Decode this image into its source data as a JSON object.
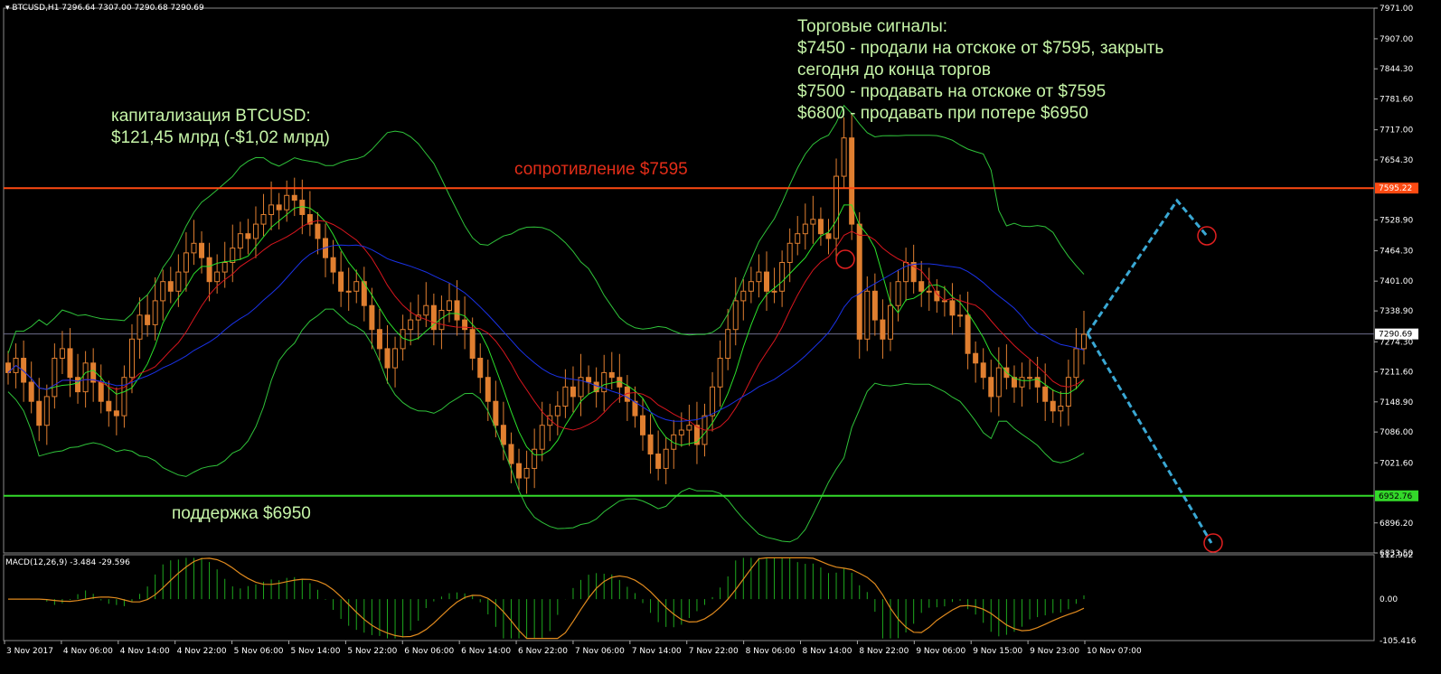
{
  "header": {
    "symbol": "BTCUSD,H1",
    "ohlc": "7296.64 7307.00 7290.68 7290.69",
    "macd_label": "MACD(12,26,9) -3.484 -29.596"
  },
  "annotations": {
    "cap_line1": "капитализация BTCUSD:",
    "cap_line2": "$121,45 млрд (-$1,02 млрд)",
    "signals": [
      "Торговые сигналы:",
      "$7450 - продали на отскоке от $7595, закрыть",
      "сегодня до конца торгов",
      "$7500 - продавать на отскоке от $7595",
      "$6800 - продавать при потере $6950"
    ],
    "resistance_label": "сопротивление $7595",
    "support_label": "поддержка $6950"
  },
  "price_axis": {
    "ticks": [
      "7971.00",
      "7907.00",
      "7844.30",
      "7781.60",
      "7717.00",
      "7654.30",
      "7528.90",
      "7464.30",
      "7401.00",
      "7338.90",
      "7274.30",
      "7211.60",
      "7148.90",
      "7086.00",
      "7021.60",
      "6896.20",
      "6833.50"
    ],
    "current_price": "7290.69",
    "resistance_price": "7595.22",
    "support_price": "6952.76"
  },
  "macd_axis": {
    "ticks": [
      "112.902",
      "0.00",
      "-105.416"
    ]
  },
  "time_axis": {
    "labels": [
      "3 Nov 2017",
      "4 Nov 06:00",
      "4 Nov 14:00",
      "4 Nov 22:00",
      "5 Nov 06:00",
      "5 Nov 14:00",
      "5 Nov 22:00",
      "6 Nov 06:00",
      "6 Nov 14:00",
      "6 Nov 22:00",
      "7 Nov 06:00",
      "7 Nov 14:00",
      "7 Nov 22:00",
      "8 Nov 06:00",
      "8 Nov 14:00",
      "8 Nov 22:00",
      "9 Nov 06:00",
      "9 Nov 15:00",
      "9 Nov 23:00",
      "10 Nov 07:00"
    ]
  },
  "colors": {
    "candle": "#e07f30",
    "resistance": "#ff4a12",
    "support": "#33d92a",
    "bollinger": "#2fc33a",
    "ma_red": "#d8161e",
    "ma_blue": "#1a32e8",
    "ma_green": "#2be22b",
    "macd_hist": "#1ea91e",
    "macd_signal": "#e08a1e",
    "forecast": "#3aa8d4"
  },
  "chart_data": {
    "type": "candlestick",
    "title": "BTCUSD,H1",
    "ylim": [
      6833.5,
      7971
    ],
    "resistance": 7595.22,
    "support": 6952.76,
    "current": 7290.69,
    "closes": [
      7210,
      7240,
      7190,
      7150,
      7100,
      7160,
      7240,
      7260,
      7200,
      7170,
      7230,
      7190,
      7150,
      7130,
      7120,
      7200,
      7280,
      7330,
      7310,
      7360,
      7400,
      7380,
      7420,
      7460,
      7480,
      7450,
      7400,
      7420,
      7440,
      7470,
      7500,
      7490,
      7520,
      7540,
      7560,
      7550,
      7580,
      7570,
      7540,
      7520,
      7490,
      7450,
      7420,
      7380,
      7380,
      7400,
      7350,
      7300,
      7260,
      7220,
      7260,
      7300,
      7320,
      7330,
      7350,
      7300,
      7340,
      7360,
      7320,
      7300,
      7240,
      7200,
      7150,
      7100,
      7060,
      7020,
      6990,
      7010,
      7050,
      7100,
      7120,
      7140,
      7180,
      7160,
      7200,
      7190,
      7170,
      7210,
      7200,
      7180,
      7150,
      7120,
      7080,
      7040,
      7010,
      7050,
      7080,
      7090,
      7100,
      7060,
      7120,
      7180,
      7240,
      7300,
      7360,
      7380,
      7400,
      7420,
      7380,
      7380,
      7440,
      7480,
      7500,
      7520,
      7530,
      7500,
      7490,
      7620,
      7700,
      7520,
      7280,
      7380,
      7320,
      7280,
      7350,
      7400,
      7440,
      7400,
      7380,
      7380,
      7360,
      7360,
      7330,
      7330,
      7250,
      7230,
      7200,
      7160,
      7220,
      7200,
      7180,
      7200,
      7200,
      7180,
      7150,
      7130,
      7140,
      7200,
      7260,
      7290
    ]
  }
}
